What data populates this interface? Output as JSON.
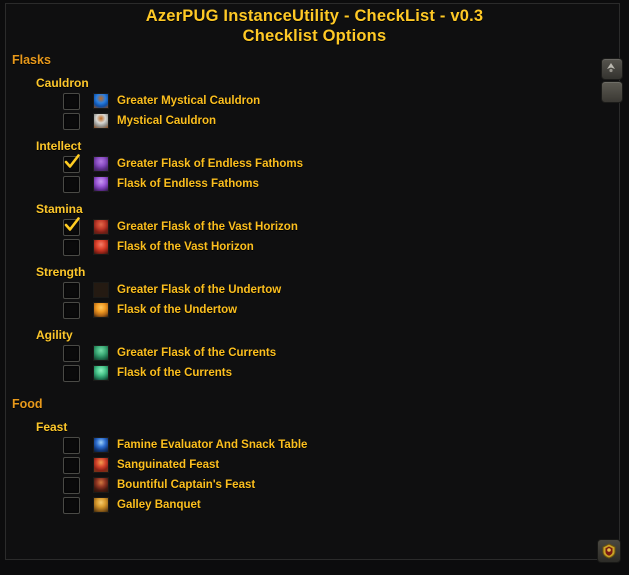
{
  "window": {
    "title_line1": "AzerPUG InstanceUtility -  CheckList - v0.3",
    "title_line2": "Checklist Options"
  },
  "controls": {
    "scroll_up_label": "scroll-up",
    "scroll_down_label": "scroll-down",
    "logo_label": "addon-logo"
  },
  "colors": {
    "group_header": "#e8991b",
    "subgroup_header": "#fdc72b",
    "item_label": "#fcbf1e",
    "title": "#ffc926",
    "background": "#0f0f10",
    "checkmark": "#ffcc22"
  },
  "groups": [
    {
      "name": "Flasks",
      "subgroups": [
        {
          "name": "Cauldron",
          "items": [
            {
              "label": "Greater Mystical Cauldron",
              "checked": false,
              "icon": "cauldron-blue-icon",
              "icon_colors": [
                "#2b7fe0",
                "#0d4fa8",
                "#8a4a1c",
                "#c06a22"
              ]
            },
            {
              "label": "Mystical Cauldron",
              "checked": false,
              "icon": "cauldron-white-icon",
              "icon_colors": [
                "#d8d8d4",
                "#8f8f8b",
                "#8a4a1c",
                "#c06a22"
              ]
            }
          ]
        },
        {
          "name": "Intellect",
          "items": [
            {
              "label": "Greater Flask of Endless Fathoms",
              "checked": true,
              "icon": "flask-purple-greater-icon",
              "icon_colors": [
                "#8a4ec4",
                "#5a2d88",
                "#3a2350",
                "#b27ae0"
              ]
            },
            {
              "label": "Flask of Endless Fathoms",
              "checked": false,
              "icon": "flask-purple-icon",
              "icon_colors": [
                "#a05ddb",
                "#6b33a0",
                "#2a1840",
                "#c79bef"
              ]
            }
          ]
        },
        {
          "name": "Stamina",
          "items": [
            {
              "label": "Greater Flask of the Vast Horizon",
              "checked": true,
              "icon": "flask-red-greater-icon",
              "icon_colors": [
                "#c23a2a",
                "#7d1f16",
                "#4a2018",
                "#e06a4a"
              ]
            },
            {
              "label": "Flask of the Vast Horizon",
              "checked": false,
              "icon": "flask-red-icon",
              "icon_colors": [
                "#e0432c",
                "#9a2418",
                "#33150f",
                "#f2806a"
              ]
            }
          ]
        },
        {
          "name": "Strength",
          "items": [
            {
              "label": "Greater Flask of the Undertow",
              "checked": false,
              "icon": "flask-orange-greater-icon",
              "icon_colors": [
                "#e08a1e",
                "#a85a10",
                "#3d2410",
                "#f5b busca"
              ]
            },
            {
              "label": "Flask of the Undertow",
              "checked": false,
              "icon": "flask-orange-icon",
              "icon_colors": [
                "#f09a22",
                "#b06616",
                "#2e1c0c",
                "#ffc860"
              ]
            }
          ]
        },
        {
          "name": "Agility",
          "items": [
            {
              "label": "Greater Flask of the Currents",
              "checked": false,
              "icon": "flask-green-greater-icon",
              "icon_colors": [
                "#3fae7a",
                "#1f7550",
                "#143227",
                "#76dba8"
              ]
            },
            {
              "label": "Flask of the Currents",
              "checked": false,
              "icon": "flask-green-icon",
              "icon_colors": [
                "#49c78c",
                "#23835c",
                "#0f2a1f",
                "#8ff0c0"
              ]
            }
          ]
        }
      ]
    },
    {
      "name": "Food",
      "subgroups": [
        {
          "name": "Feast",
          "items": [
            {
              "label": "Famine Evaluator And Snack Table",
              "checked": false,
              "icon": "snack-table-blue-icon",
              "icon_colors": [
                "#2f6fd0",
                "#123a80",
                "#0a1a33",
                "#9fd0f5"
              ]
            },
            {
              "label": "Sanguinated Feast",
              "checked": false,
              "icon": "feast-red-icon",
              "icon_colors": [
                "#d4442c",
                "#8d2216",
                "#6a3a18",
                "#f0a050"
              ]
            },
            {
              "label": "Bountiful Captain's Feast",
              "checked": false,
              "icon": "feast-dark-red-icon",
              "icon_colors": [
                "#8f3422",
                "#4a1a10",
                "#2a1208",
                "#d07a40"
              ]
            },
            {
              "label": "Galley Banquet",
              "checked": false,
              "icon": "feast-gold-icon",
              "icon_colors": [
                "#d89a2c",
                "#96631a",
                "#3d280c",
                "#f5cc70"
              ]
            }
          ]
        }
      ]
    }
  ]
}
